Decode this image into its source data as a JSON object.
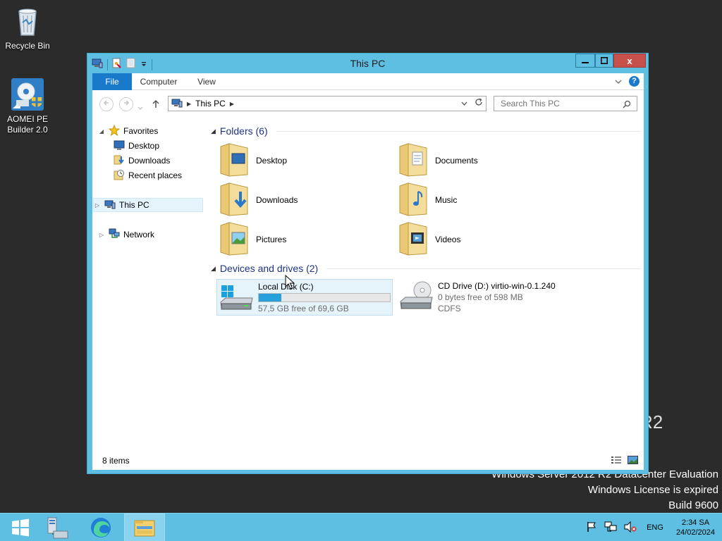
{
  "desktop": {
    "icons": [
      {
        "label": "Recycle Bin"
      },
      {
        "label": "AOMEI PE Builder 2.0"
      }
    ],
    "watermark": {
      "edition": "R2",
      "line1": "Windows Server 2012 R2 Datacenter Evaluation",
      "line2": "Windows License is expired",
      "line3": "Build 9600"
    }
  },
  "window": {
    "title": "This PC",
    "controls": {
      "minimize": "—",
      "maximize": "□",
      "close": "x"
    }
  },
  "ribbon": {
    "tabs": [
      "File",
      "Computer",
      "View"
    ],
    "help": "?"
  },
  "address": {
    "location": "This PC",
    "search_placeholder": "Search This PC"
  },
  "navpane": {
    "favorites": "Favorites",
    "favorite_items": [
      "Desktop",
      "Downloads",
      "Recent places"
    ],
    "this_pc": "This PC",
    "network": "Network"
  },
  "content": {
    "folders_header": "Folders (6)",
    "folders": [
      "Desktop",
      "Documents",
      "Downloads",
      "Music",
      "Pictures",
      "Videos"
    ],
    "devices_header": "Devices and drives (2)",
    "drives": [
      {
        "name": "Local Disk (C:)",
        "free": "57,5 GB free of 69,6 GB",
        "used_fraction": 0.17
      },
      {
        "name": "CD Drive (D:) virtio-win-0.1.240",
        "free": "0 bytes free of 598 MB",
        "fs": "CDFS"
      }
    ]
  },
  "status": {
    "items": "8 items"
  },
  "taskbar": {
    "lang": "ENG",
    "time": "2:34 SA",
    "date": "24/02/2024"
  },
  "colors": {
    "window_frame": "#5ebfe3",
    "file_tab": "#1979ca",
    "group_header": "#1e3287",
    "close_button": "#c7504c",
    "drive_bar": "#26a0da"
  }
}
